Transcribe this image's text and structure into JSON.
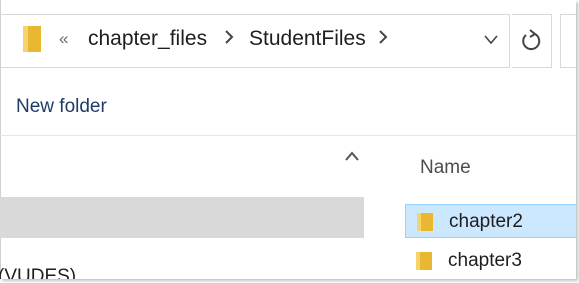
{
  "address_bar": {
    "overflow_chevron": "«",
    "breadcrumbs": [
      "chapter_files",
      "StudentFiles"
    ],
    "separator": ">",
    "dropdown_icon": "chevron-down-icon",
    "refresh_icon": "refresh-icon"
  },
  "toolbar": {
    "new_folder_label": "New folder"
  },
  "nav_pane": {
    "scroll_up_icon": "scroll-up-arrow-icon",
    "partial_item_label": "(VUDES)"
  },
  "content": {
    "column_header": "Name",
    "files": [
      {
        "name": "chapter2",
        "selected": true,
        "icon": "folder-icon"
      },
      {
        "name": "chapter3",
        "selected": false,
        "icon": "folder-icon"
      }
    ]
  },
  "colors": {
    "folder": "#e8b830",
    "selection": "#cce8ff",
    "nav_selection": "#d9d9d9"
  }
}
